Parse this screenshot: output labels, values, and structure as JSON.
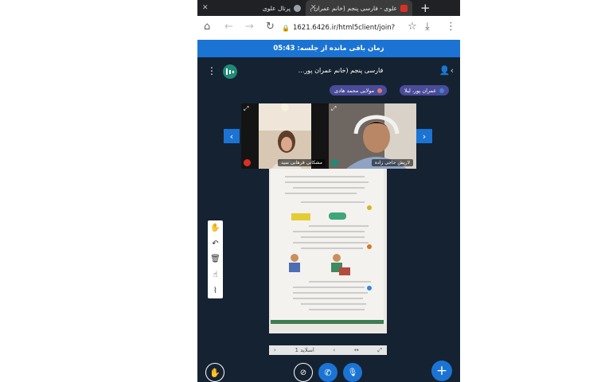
{
  "browser": {
    "tabs": [
      {
        "title": "پرتال علوی",
        "active": false
      },
      {
        "title": "علوی - فارسی پنجم (خانم عمران پو",
        "active": true
      }
    ],
    "new_tab": "+",
    "url": "1621.6426.ir/html5client/join?",
    "colors": {
      "tabstrip": "#202124",
      "active_tab": "#3c3c3c"
    }
  },
  "session": {
    "timer_label": "زمان باقی مانده از جلسه: 05:43",
    "colors": {
      "timer_bar": "#1b74d3",
      "background": "#152232"
    }
  },
  "header": {
    "room_title": "فارسی پنجم (خانم عمران پور...",
    "logo_icon": "bar-chart-logo-icon"
  },
  "talking": [
    {
      "name": "عمران پور، لیلا"
    },
    {
      "name": "مولایی محمد هادی"
    }
  ],
  "videos": [
    {
      "name": "لاریش حاجی زاده"
    },
    {
      "name": "مشکانی فرهانی سید"
    }
  ],
  "whiteboard_tools": [
    "hand-icon",
    "undo-icon",
    "delete-icon",
    "pointer-icon",
    "multi-user-icon"
  ],
  "slide": {
    "page": "اسلاید 1"
  },
  "actions": {
    "raise_hand": "raise-hand-icon",
    "camera": "camera-off-icon",
    "phone": "phone-icon",
    "mic": "microphone-icon",
    "add": "plus-icon"
  }
}
